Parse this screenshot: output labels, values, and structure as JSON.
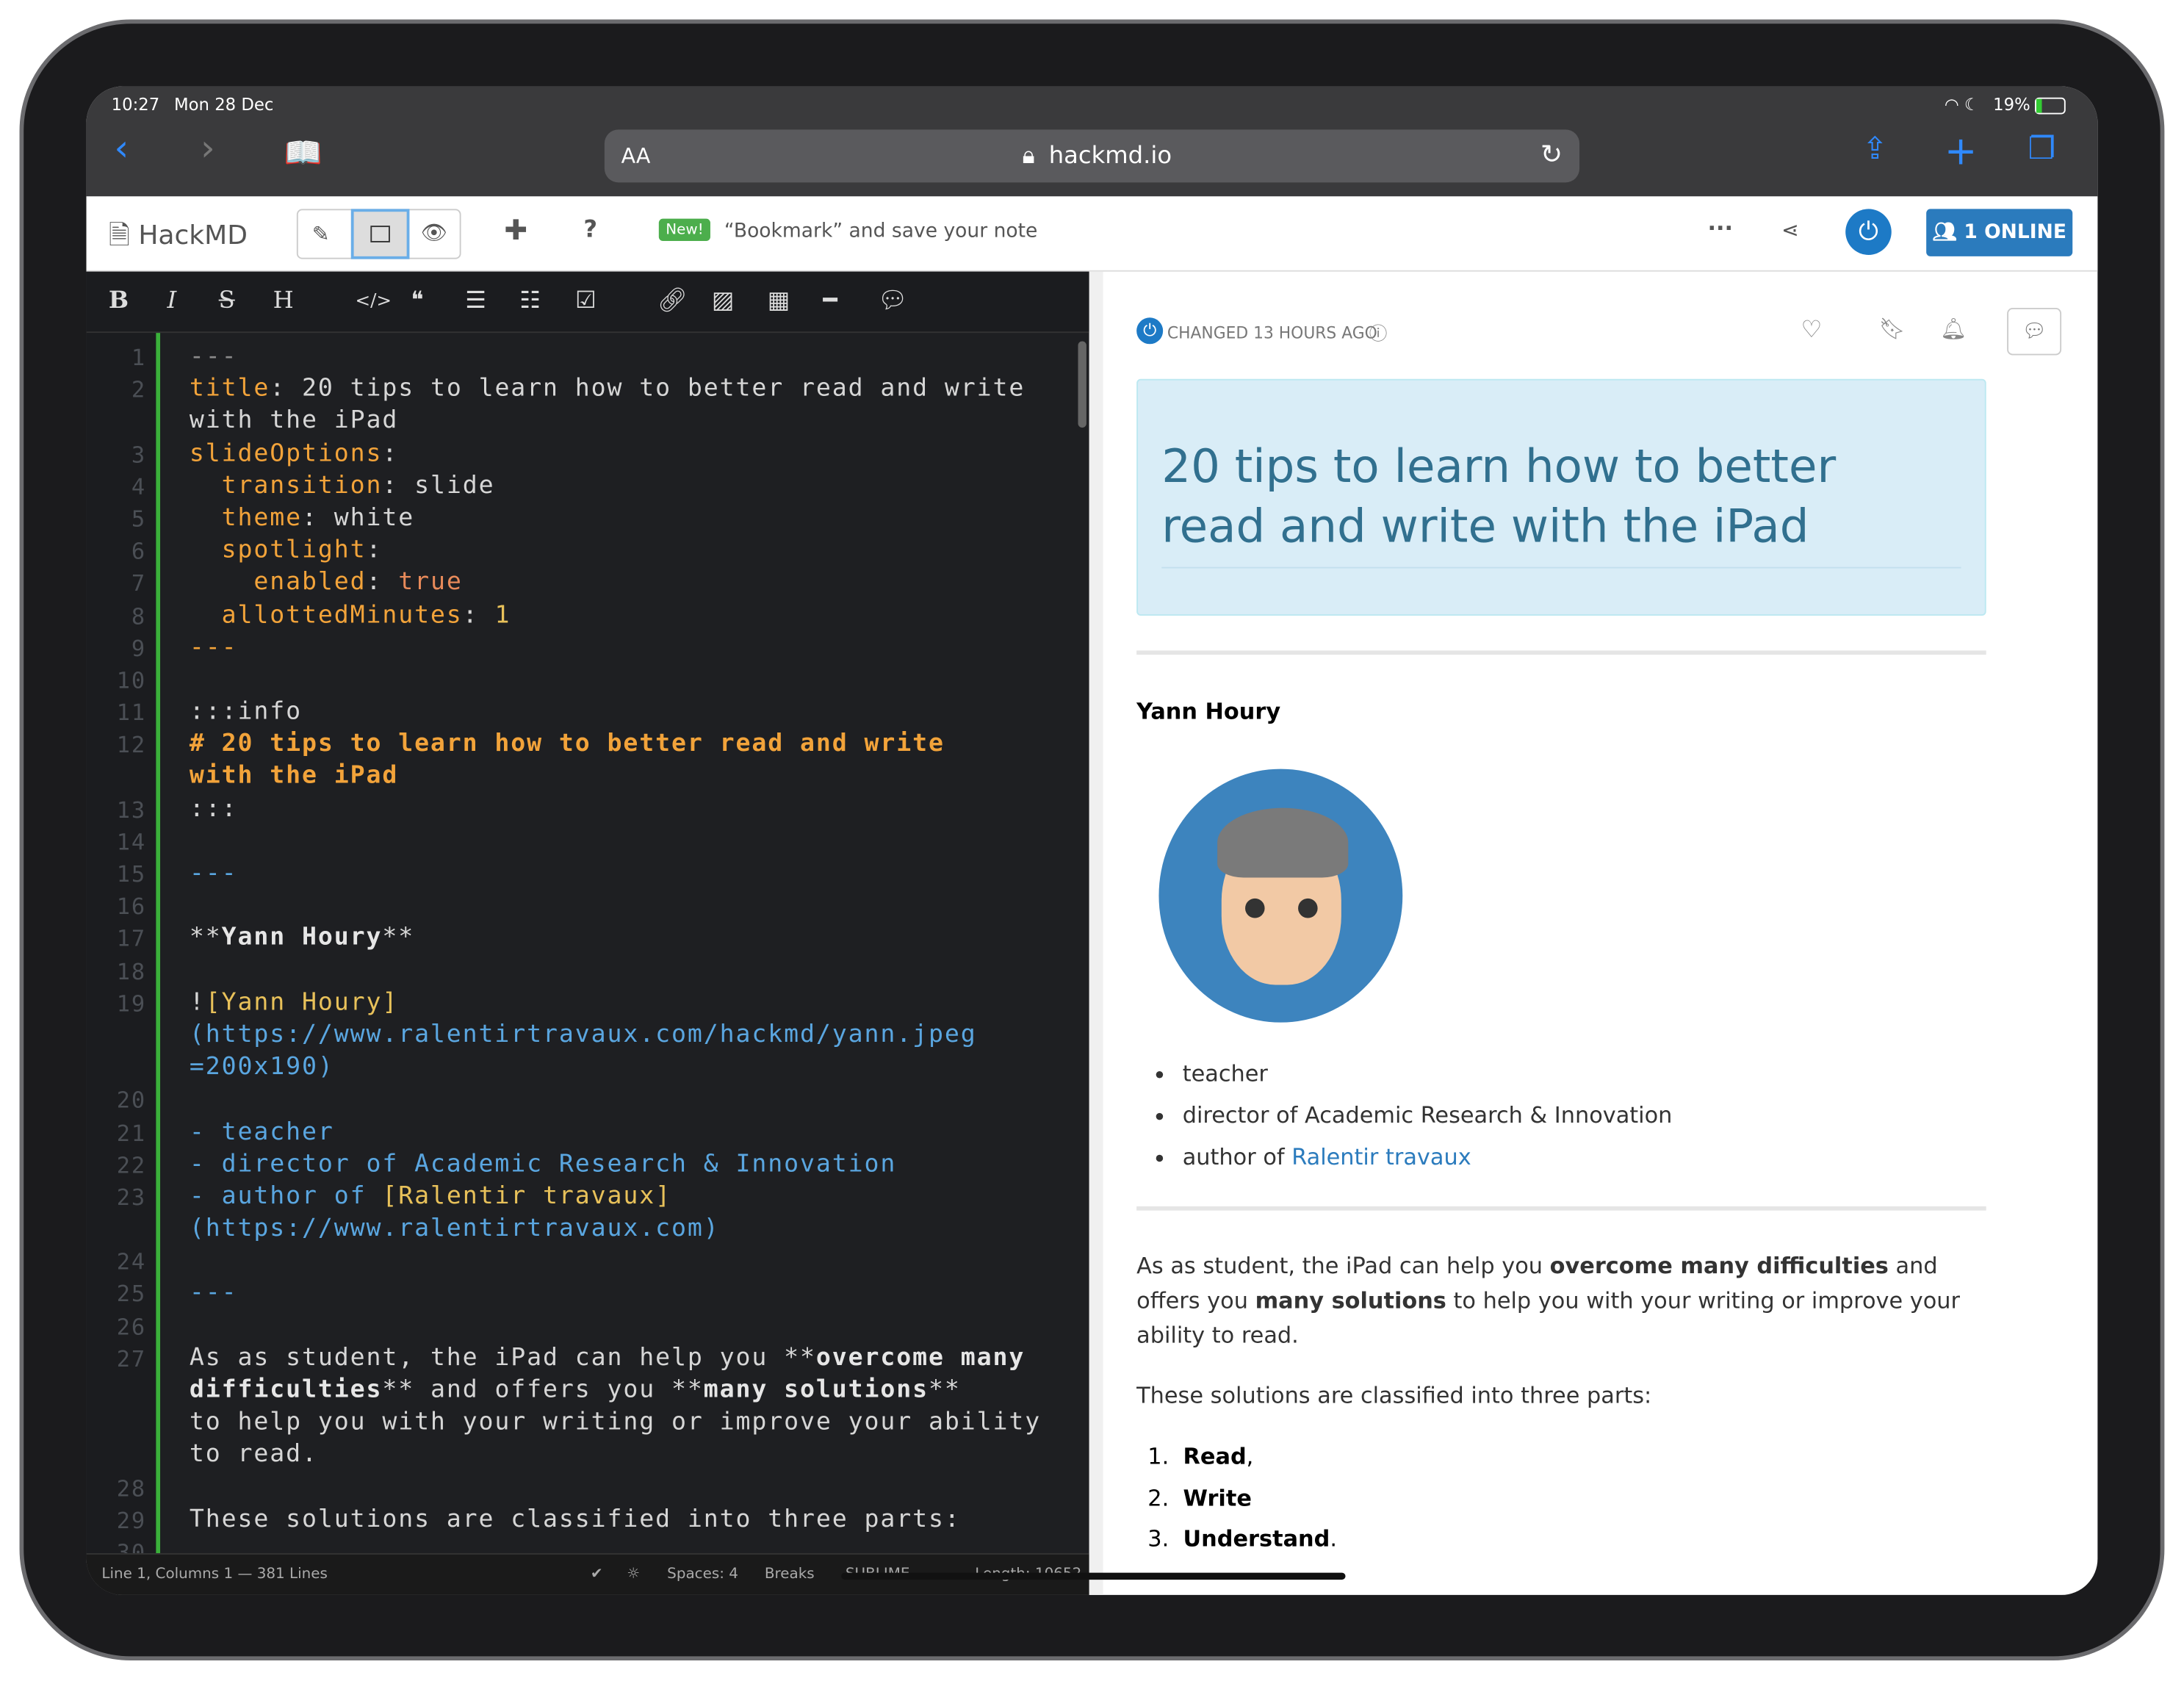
{
  "status_bar": {
    "time": "10:27",
    "date": "Mon 28 Dec",
    "battery": "19%"
  },
  "safari": {
    "text_size": "AA",
    "url": "hackmd.io"
  },
  "hackmd": {
    "brand": "HackMD",
    "new_badge": "New!",
    "announcement": "“Bookmark” and save your note",
    "online_button": "1 ONLINE",
    "accent": "#2b7bbd"
  },
  "editor": {
    "toolbar": [
      "B",
      "I",
      "S",
      "H",
      "</>",
      "❝",
      "list",
      "numbered-list",
      "check",
      "link",
      "image",
      "table",
      "hr",
      "comment"
    ],
    "rows": [
      {
        "n": "1",
        "s": [
          [
            "---",
            "c-g"
          ]
        ]
      },
      {
        "n": "2",
        "s": [
          [
            "title",
            "c-o"
          ],
          [
            ": 20 tips to learn how to better read and write",
            "c-w"
          ]
        ]
      },
      {
        "n": "",
        "s": [
          [
            "with the iPad",
            "c-w"
          ]
        ]
      },
      {
        "n": "3",
        "s": [
          [
            "slideOptions",
            "c-o"
          ],
          [
            ":",
            "c-w"
          ]
        ]
      },
      {
        "n": "4",
        "s": [
          [
            "  transition",
            "c-o"
          ],
          [
            ": slide",
            "c-w"
          ]
        ]
      },
      {
        "n": "5",
        "s": [
          [
            "  theme",
            "c-o"
          ],
          [
            ": white",
            "c-w"
          ]
        ]
      },
      {
        "n": "6",
        "s": [
          [
            "  spotlight",
            "c-o"
          ],
          [
            ":",
            "c-w"
          ]
        ]
      },
      {
        "n": "7",
        "s": [
          [
            "    enabled",
            "c-o"
          ],
          [
            ": ",
            "c-w"
          ],
          [
            "true",
            "c-r"
          ]
        ]
      },
      {
        "n": "8",
        "s": [
          [
            "  allottedMinutes",
            "c-o"
          ],
          [
            ": ",
            "c-w"
          ],
          [
            "1",
            "c-y"
          ]
        ]
      },
      {
        "n": "9",
        "s": [
          [
            "---",
            "c-o"
          ]
        ]
      },
      {
        "n": "10",
        "s": []
      },
      {
        "n": "11",
        "s": [
          [
            ":::info",
            "c-w"
          ]
        ]
      },
      {
        "n": "12",
        "s": [
          [
            "# 20 tips to learn how to better read and write",
            "c-ob"
          ]
        ]
      },
      {
        "n": "",
        "s": [
          [
            "with the iPad",
            "c-ob"
          ]
        ]
      },
      {
        "n": "13",
        "s": [
          [
            ":::",
            "c-w"
          ]
        ]
      },
      {
        "n": "14",
        "s": []
      },
      {
        "n": "15",
        "s": [
          [
            "---",
            "c-b"
          ]
        ]
      },
      {
        "n": "16",
        "s": []
      },
      {
        "n": "17",
        "s": [
          [
            "**",
            "c-w"
          ],
          [
            "Yann Houry",
            "c-bold"
          ],
          [
            "**",
            "c-w"
          ]
        ]
      },
      {
        "n": "18",
        "s": []
      },
      {
        "n": "19",
        "s": [
          [
            "!",
            "c-w"
          ],
          [
            "[Yann Houry]",
            "c-y"
          ]
        ]
      },
      {
        "n": "",
        "s": [
          [
            "(https://www.ralentirtravaux.com/hackmd/yann.jpeg",
            "c-b"
          ]
        ]
      },
      {
        "n": "",
        "s": [
          [
            "=200x190)",
            "c-b"
          ]
        ]
      },
      {
        "n": "20",
        "s": []
      },
      {
        "n": "21",
        "s": [
          [
            "- teacher",
            "c-b"
          ]
        ]
      },
      {
        "n": "22",
        "s": [
          [
            "- director of Academic Research & Innovation",
            "c-b"
          ]
        ]
      },
      {
        "n": "23",
        "s": [
          [
            "- author of ",
            "c-b"
          ],
          [
            "[Ralentir travaux]",
            "c-y"
          ]
        ]
      },
      {
        "n": "",
        "s": [
          [
            "(https://www.ralentirtravaux.com)",
            "c-b"
          ]
        ]
      },
      {
        "n": "24",
        "s": []
      },
      {
        "n": "25",
        "s": [
          [
            "---",
            "c-b"
          ]
        ]
      },
      {
        "n": "26",
        "s": []
      },
      {
        "n": "27",
        "s": [
          [
            "As as student, the iPad can help you **",
            "c-w"
          ],
          [
            "overcome many",
            "c-bold"
          ]
        ]
      },
      {
        "n": "",
        "s": [
          [
            "difficulties",
            "c-bold"
          ],
          [
            "** and offers you **",
            "c-w"
          ],
          [
            "many solutions",
            "c-bold"
          ],
          [
            "**",
            "c-w"
          ]
        ]
      },
      {
        "n": "",
        "s": [
          [
            "to help you with your writing or improve your ability",
            "c-w"
          ]
        ]
      },
      {
        "n": "",
        "s": [
          [
            "to read.",
            "c-w"
          ]
        ]
      },
      {
        "n": "28",
        "s": []
      },
      {
        "n": "29",
        "s": [
          [
            "These solutions are classified into three parts:",
            "c-w"
          ]
        ]
      },
      {
        "n": "30",
        "s": []
      }
    ],
    "statusbar": {
      "position": "Line 1, Columns 1 — 381 Lines",
      "spaces": "Spaces: 4",
      "breaks": "Breaks",
      "keymap": "SUBLIME",
      "length": "Length: 10652"
    }
  },
  "preview": {
    "changed": "CHANGED 13 HOURS AGO",
    "title": "20 tips to learn how to better read and write with the iPad",
    "author": "Yann Houry",
    "bullets": [
      "teacher",
      "director of Academic Research & Innovation"
    ],
    "bullet3_prefix": "author of ",
    "bullet3_link": "Ralentir travaux",
    "para1": {
      "a": "As as student, the iPad can help you ",
      "b": "overcome many difficulties",
      "c": " and offers you ",
      "d": "many solutions",
      "e": " to help you with your writing or improve your ability to read."
    },
    "para2": "These solutions are classified into three parts:",
    "ordered": [
      {
        "n": "1.",
        "b": "Read",
        "t": ","
      },
      {
        "n": "2.",
        "b": "Write",
        "t": ""
      },
      {
        "n": "3.",
        "b": "Understand",
        "t": "."
      }
    ]
  }
}
